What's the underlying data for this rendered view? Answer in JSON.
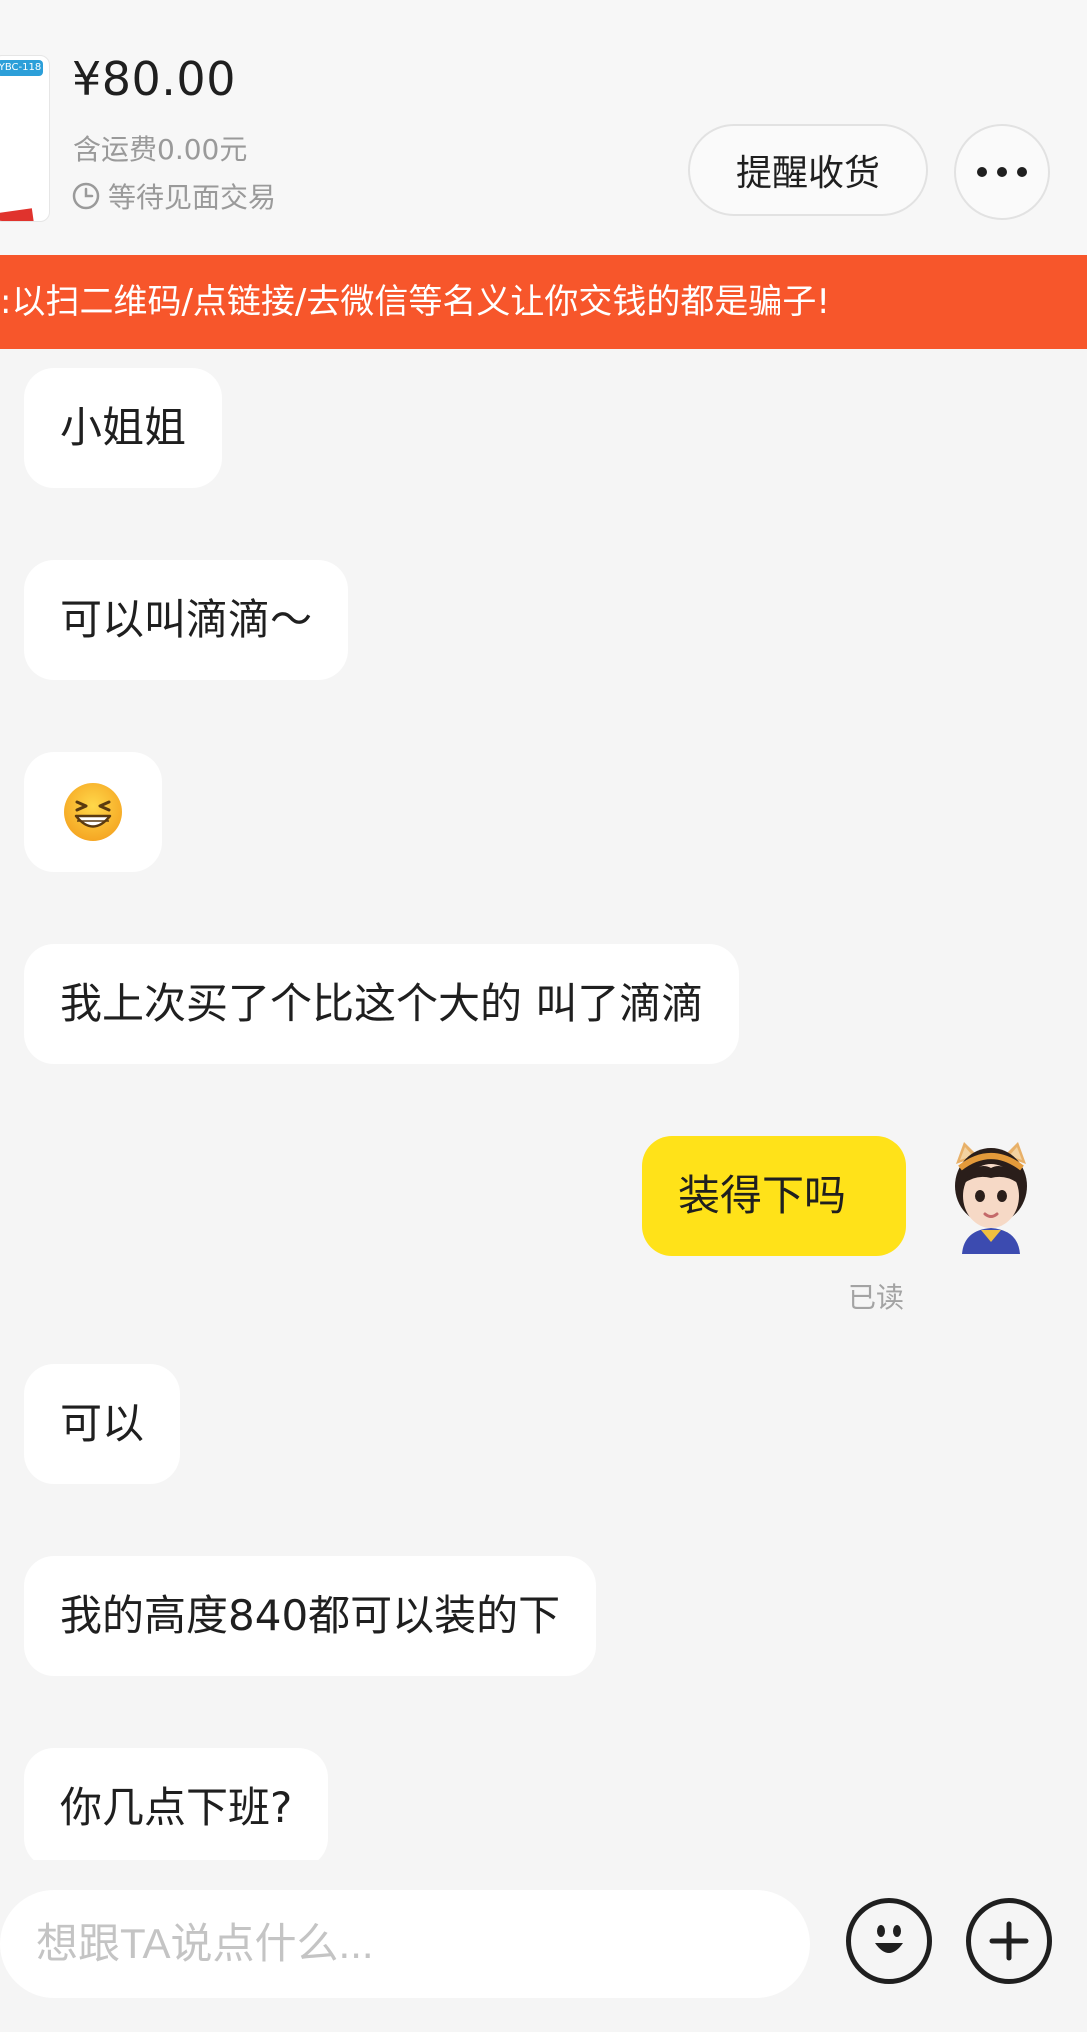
{
  "order": {
    "price": "¥80.00",
    "shipping": "含运费0.00元",
    "status": "等待见面交易",
    "remind_label": "提醒收货",
    "thumb_tag": "YBC-118"
  },
  "warning": {
    "text": ":以扫二维码/点链接/去微信等名义让你交钱的都是骗子!"
  },
  "messages": [
    {
      "side": "other",
      "text": "小姐姐"
    },
    {
      "side": "other",
      "text": "可以叫滴滴～"
    },
    {
      "side": "other",
      "emoji": "grinning-squinting-face"
    },
    {
      "side": "other",
      "text": "我上次买了个比这个大的 叫了滴滴"
    },
    {
      "side": "me",
      "text": "装得下吗",
      "status": "已读"
    },
    {
      "side": "other",
      "text": "可以"
    },
    {
      "side": "other",
      "text": "我的高度840都可以装的下"
    },
    {
      "side": "other",
      "text": "你几点下班?"
    }
  ],
  "composer": {
    "placeholder": "想跟TA说点什么..."
  },
  "icons": {
    "clock": "clock-icon",
    "more": "more-dots-icon",
    "emoji": "emoji-icon",
    "plus": "plus-icon"
  },
  "colors": {
    "warning_bg": "#f7562b",
    "my_bubble": "#ffe219",
    "their_bubble": "#ffffff"
  }
}
